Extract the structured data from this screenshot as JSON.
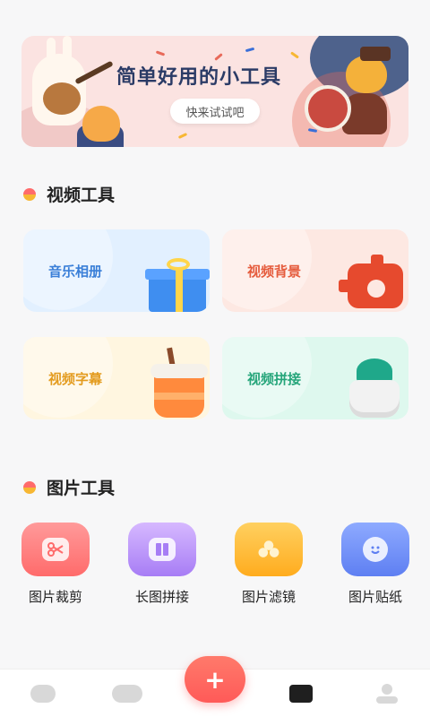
{
  "banner": {
    "title": "简单好用的小工具",
    "button_label": "快来试试吧"
  },
  "video_tools": {
    "title": "视频工具",
    "cards": [
      {
        "label": "音乐相册",
        "icon": "gift-icon"
      },
      {
        "label": "视频背景",
        "icon": "gear-icon"
      },
      {
        "label": "视频字幕",
        "icon": "cup-icon"
      },
      {
        "label": "视频拼接",
        "icon": "plant-icon"
      }
    ]
  },
  "image_tools": {
    "title": "图片工具",
    "items": [
      {
        "label": "图片裁剪",
        "icon": "scissors-icon"
      },
      {
        "label": "长图拼接",
        "icon": "columns-icon"
      },
      {
        "label": "图片滤镜",
        "icon": "filter-icon"
      },
      {
        "label": "图片贴纸",
        "icon": "sticker-icon"
      }
    ]
  },
  "bottom_nav": {
    "items": [
      {
        "icon": "home-icon"
      },
      {
        "icon": "toggle-icon"
      },
      {
        "icon": "add-icon",
        "label": "+"
      },
      {
        "icon": "toolbox-icon"
      },
      {
        "icon": "profile-icon"
      }
    ]
  },
  "colors": {
    "accent": "#ff5a58",
    "video_card_1": "#e2f0ff",
    "video_card_2": "#fde8e2",
    "video_card_3": "#fff6e0",
    "video_card_4": "#def8ee"
  }
}
